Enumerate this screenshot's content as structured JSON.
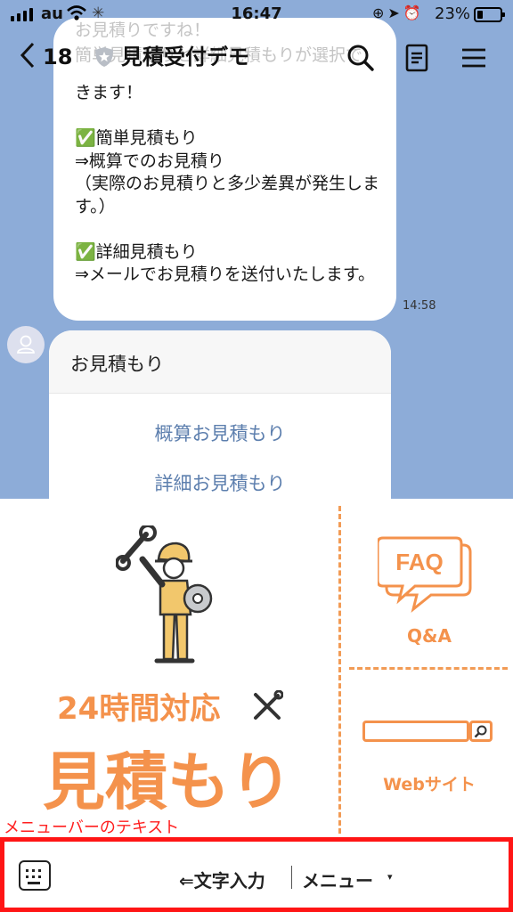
{
  "status_bar": {
    "carrier": "au",
    "time": "16:47",
    "battery": "23%",
    "battery_level": 0.23
  },
  "header": {
    "unread_count": "18",
    "title": "見積受付デモ"
  },
  "messages": {
    "ghost_line_1": "お見積りですね！",
    "ghost_line_2": "簡単見積もりと詳細見積もりが選択で",
    "body": "きます！\n\n✅簡単見積もり\n⇒概算でのお見積り\n（実際のお見積りと多少差異が発生します。）\n\n✅詳細見積もり\n⇒メールでお見積りを送付いたします。",
    "time": "14:58"
  },
  "card": {
    "title": "お見積もり",
    "options": [
      "概算お見積もり",
      "詳細お見積もり"
    ]
  },
  "rich_menu": {
    "headline": "24時間対応",
    "big_text": "見積もり",
    "faq_icon_text": "FAQ",
    "qa_label": "Q&A",
    "web_label": "Webサイト",
    "accent_color": "#f4924c"
  },
  "annotation": "メニューバーのテキスト",
  "bottom_bar": {
    "input_label": "⇐文字入力",
    "menu_label": "メニュー",
    "caret": "▾",
    "highlight_color": "#ff1515"
  }
}
